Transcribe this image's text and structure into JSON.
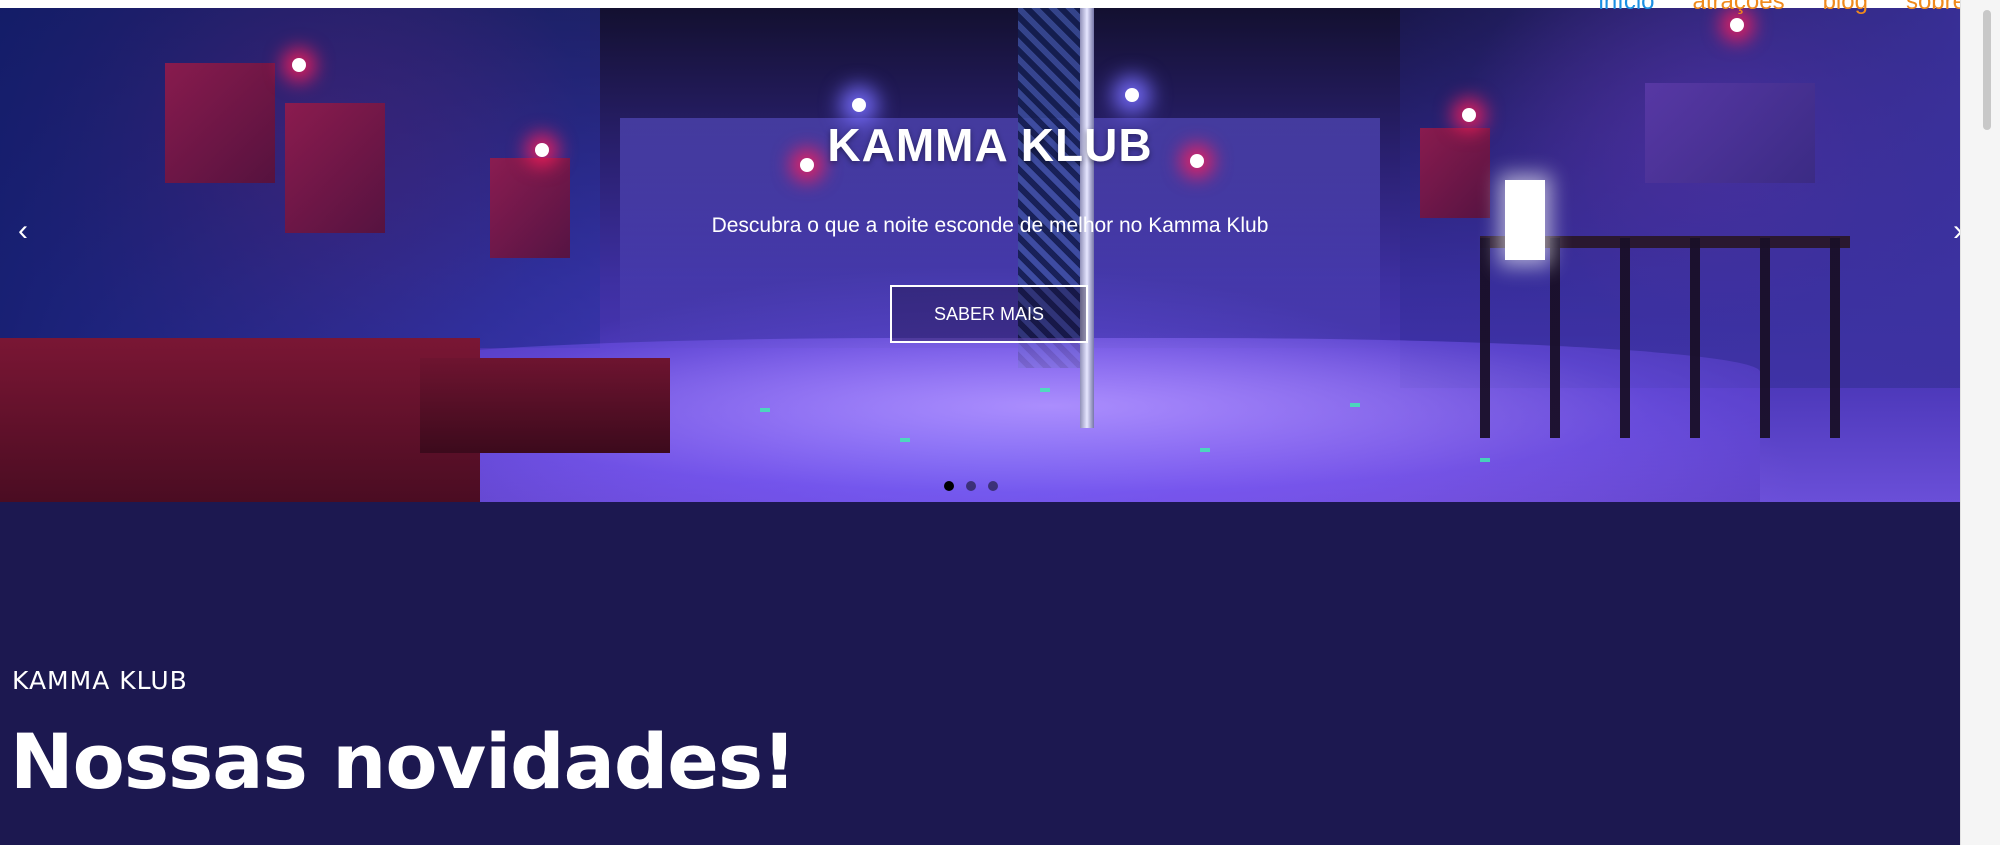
{
  "nav": {
    "items": [
      {
        "label": "início",
        "color": "#1a8fe3"
      },
      {
        "label": "atrações",
        "color": "#f08a1c"
      },
      {
        "label": "blog",
        "color": "#f08a1c"
      },
      {
        "label": "sobre",
        "color": "#f08a1c"
      }
    ]
  },
  "hero": {
    "title": "KAMMA KLUB",
    "subtitle": "Descubra o que a noite esconde de melhor no Kamma Klub",
    "button_label": "SABER MAIS",
    "prev_arrow": "‹",
    "next_arrow": "›",
    "slide_indicators": 3,
    "active_indicator": 1
  },
  "news": {
    "kicker": "KAMMA KLUB",
    "title": "Nossas novidades!",
    "background": "#1c1850"
  },
  "icons": {
    "prev": "chevron-left-icon",
    "next": "chevron-right-icon"
  }
}
